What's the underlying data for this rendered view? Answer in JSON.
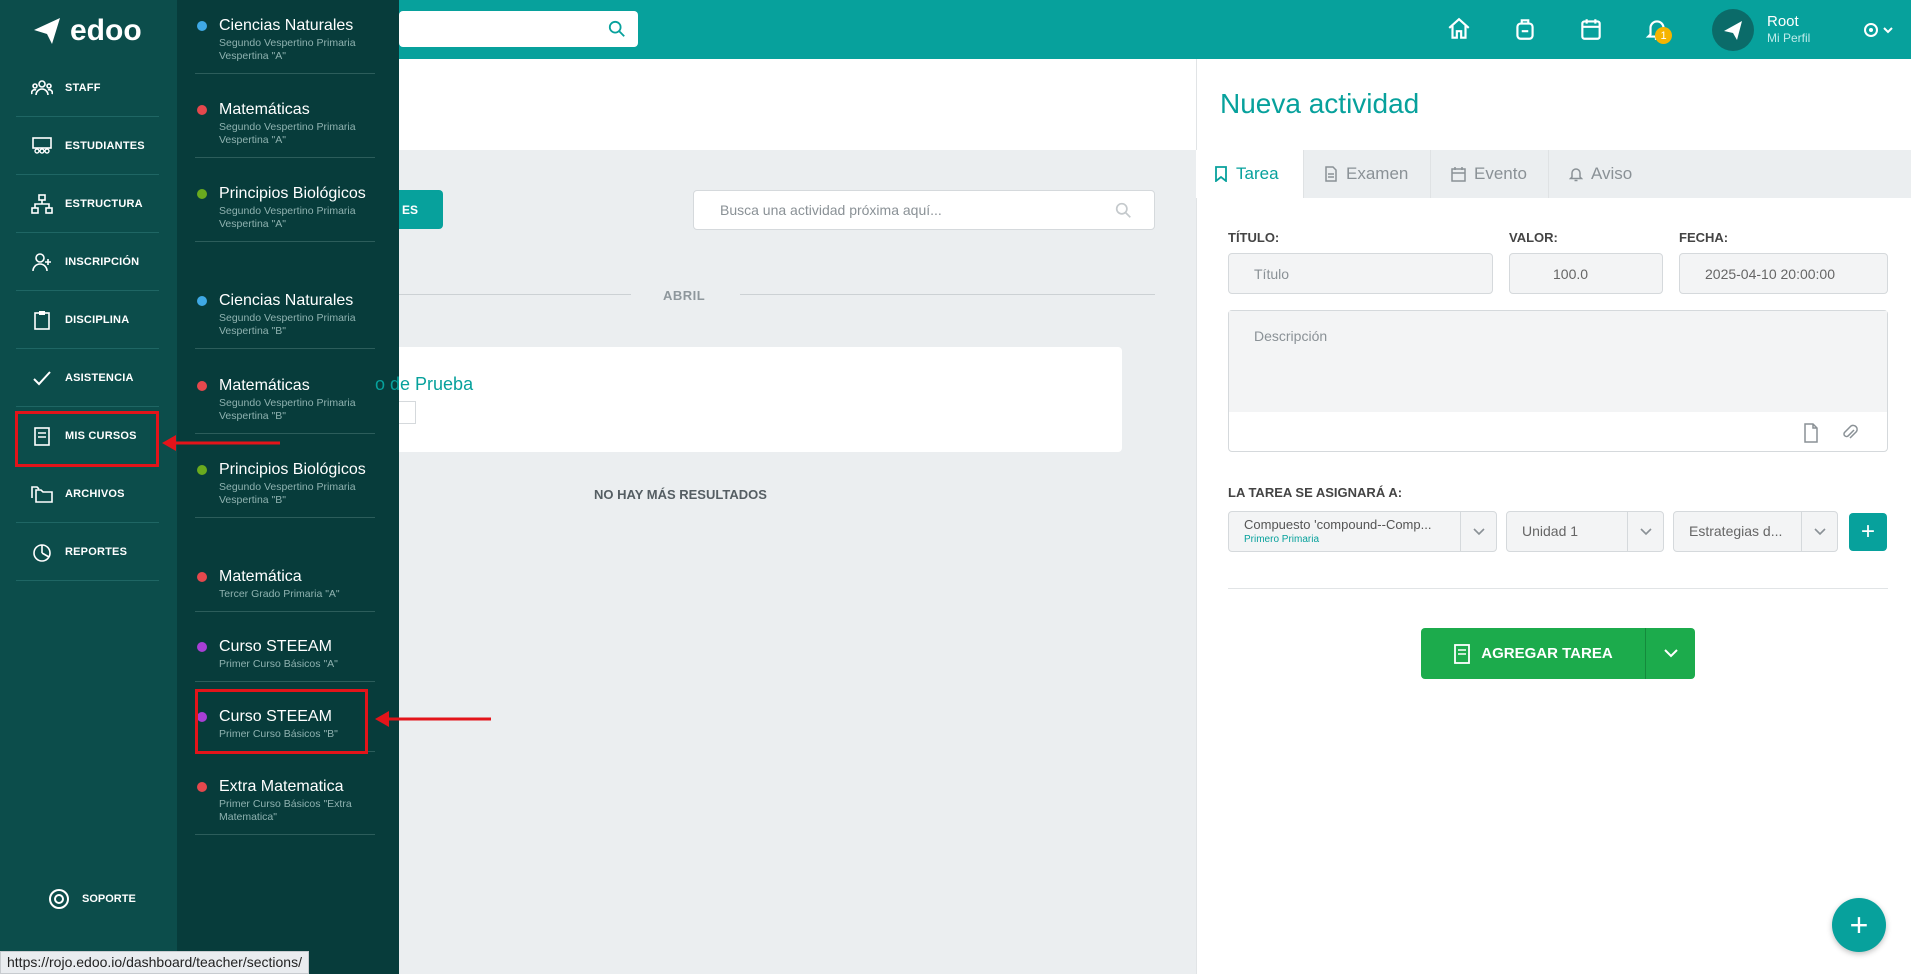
{
  "app": {
    "logo_text": "edoo"
  },
  "colors": {
    "teal": "#07a19c",
    "nav_bg": "#0c4d4b",
    "flyout_bg": "#073c3b",
    "green": "#1cab4c",
    "annotation_red": "#e3141a"
  },
  "topbar": {
    "icons": [
      "home-icon",
      "backpack-icon",
      "calendar-icon",
      "bell-icon",
      "settings-icon"
    ],
    "notification_count": "1",
    "user_name": "Root",
    "user_sub": "Mi Perfil"
  },
  "nav": {
    "items": [
      {
        "label": "STAFF",
        "icon": "staff-icon"
      },
      {
        "label": "ESTUDIANTES",
        "icon": "students-icon"
      },
      {
        "label": "ESTRUCTURA",
        "icon": "structure-icon"
      },
      {
        "label": "INSCRIPCIÓN",
        "icon": "add-user-icon"
      },
      {
        "label": "DISCIPLINA",
        "icon": "clipboard-icon"
      },
      {
        "label": "ASISTENCIA",
        "icon": "check-icon"
      },
      {
        "label": "MIS CURSOS",
        "icon": "book-icon"
      },
      {
        "label": "ARCHIVOS",
        "icon": "folders-icon"
      },
      {
        "label": "REPORTES",
        "icon": "pie-chart-icon"
      }
    ],
    "support": "SOPORTE"
  },
  "courses": [
    {
      "name": "Ciencias Naturales",
      "sub": "Segundo Vespertino Primaria Vespertina \"A\"",
      "color": "#3fa9e5"
    },
    {
      "name": "Matemáticas",
      "sub": "Segundo Vespertino Primaria Vespertina \"A\"",
      "color": "#e5484d"
    },
    {
      "name": "Principios Biológicos",
      "sub": "Segundo Vespertino Primaria Vespertina \"A\"",
      "color": "#6aaa1e"
    },
    {
      "name": "Ciencias Naturales",
      "sub": "Segundo Vespertino Primaria Vespertina \"B\"",
      "color": "#3fa9e5"
    },
    {
      "name": "Matemáticas",
      "sub": "Segundo Vespertino Primaria Vespertina \"B\"",
      "color": "#e5484d"
    },
    {
      "name": "Principios Biológicos",
      "sub": "Segundo Vespertino Primaria Vespertina \"B\"",
      "color": "#6aaa1e"
    },
    {
      "name": "Matemática",
      "sub": "Tercer Grado Primaria \"A\"",
      "color": "#e5484d"
    },
    {
      "name": "Curso STEEAM",
      "sub": "Primer Curso Básicos \"A\"",
      "color": "#a83fd6"
    },
    {
      "name": "Curso STEEAM",
      "sub": "Primer Curso Básicos \"B\"",
      "color": "#a83fd6"
    },
    {
      "name": "Extra Matematica",
      "sub": "Primer Curso Básicos \"Extra Matematica\"",
      "color": "#e5484d"
    }
  ],
  "status_url": "https://rojo.edoo.io/dashboard/teacher/sections/",
  "center": {
    "button_label": "ES",
    "search_placeholder": "Busca una actividad próxima aquí...",
    "month": "ABRIL",
    "card_title": "o de Prueba",
    "no_more": "NO HAY MÁS RESULTADOS"
  },
  "panel": {
    "title": "Nueva actividad",
    "tabs": [
      {
        "label": "Tarea",
        "icon": "bookmark-icon"
      },
      {
        "label": "Examen",
        "icon": "document-icon"
      },
      {
        "label": "Evento",
        "icon": "calendar-icon"
      },
      {
        "label": "Aviso",
        "icon": "bell-icon"
      }
    ],
    "title_label": "TÍTULO:",
    "title_placeholder": "Título",
    "value_label": "VALOR:",
    "value": "100.0",
    "date_label": "FECHA:",
    "date": "2025-04-10 20:00:00",
    "description_placeholder": "Descripción",
    "assign_label": "LA TAREA SE ASIGNARÁ A:",
    "select_course": "Compuesto 'compound--Comp...",
    "select_course_sub": "Primero Primaria",
    "select_unit": "Unidad 1",
    "select_strategy": "Estrategias d...",
    "submit": "AGREGAR TAREA"
  }
}
